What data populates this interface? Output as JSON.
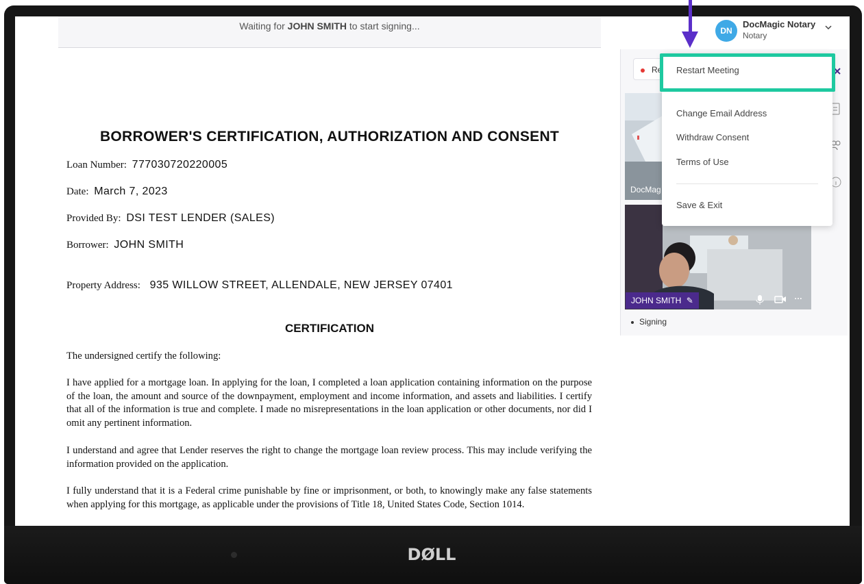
{
  "device": {
    "brand": "DØLL"
  },
  "status": {
    "prefix": "Waiting for",
    "name": "JOHN SMITH",
    "suffix": "to start signing..."
  },
  "document": {
    "title": "BORROWER'S CERTIFICATION, AUTHORIZATION AND CONSENT",
    "fields": [
      {
        "label": "Loan Number:",
        "value": "777030720220005"
      },
      {
        "label": "Date:",
        "value": "March 7, 2023"
      },
      {
        "label": "Provided By:",
        "value": "DSI TEST LENDER (SALES)"
      },
      {
        "label": "Borrower:",
        "value": "JOHN SMITH"
      },
      {
        "label": "Property Address:",
        "value": "935 WILLOW STREET, ALLENDALE, NEW JERSEY 07401"
      }
    ],
    "section_heading": "CERTIFICATION",
    "paragraphs": [
      "The undersigned certify the following:",
      "I have applied for a mortgage loan. In applying for the loan, I completed a loan application containing information on the purpose of the loan, the amount and source of the downpayment, employment and income information, and assets and liabilities. I certify that all of the information is true and complete. I made no misrepresentations in the loan application or other documents, nor did I omit any pertinent information.",
      "I understand and agree that Lender reserves the right to change the mortgage loan review process. This may include verifying the information provided on the application.",
      "I fully understand that it is a Federal crime punishable by fine or imprisonment, or both, to knowingly make any false statements when applying for this mortgage, as applicable under the provisions of Title 18, United States Code, Section 1014."
    ]
  },
  "user": {
    "initials": "DN",
    "name": "DocMagic Notary",
    "role": "Notary"
  },
  "recording": {
    "label": "Re"
  },
  "participants": [
    {
      "name": "DocMag"
    },
    {
      "name": "JOHN SMITH"
    }
  ],
  "participant_status": "Signing",
  "menu": {
    "items": [
      "Restart Meeting",
      "Change Email Address",
      "Withdraw Consent",
      "Terms of Use",
      "Save & Exit"
    ],
    "highlighted": "Restart Meeting"
  },
  "colors": {
    "highlight": "#1ec9a0",
    "arrow": "#5b2fc9",
    "name_tag": "#4b2a8c",
    "avatar": "#3fa9e6"
  },
  "icons": [
    "chevron-down-icon",
    "mic-icon",
    "video-icon",
    "more-icon",
    "pencil-icon",
    "document-icon",
    "people-icon",
    "info-icon"
  ]
}
